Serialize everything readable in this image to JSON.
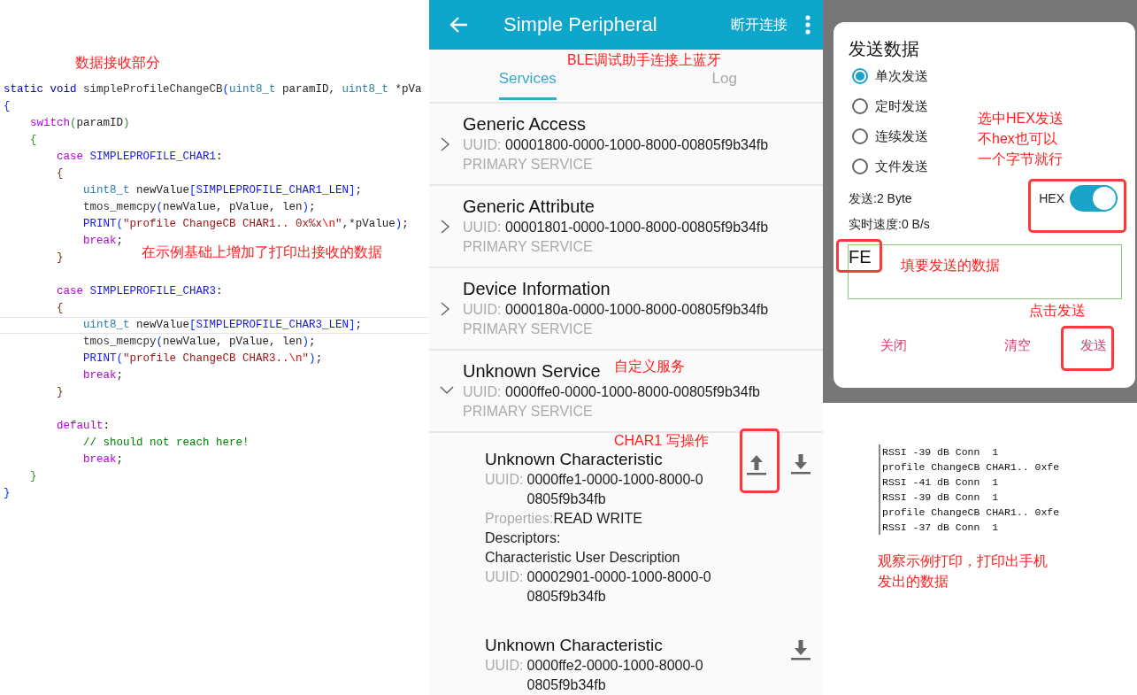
{
  "code": {
    "lines": [
      {
        "kind": "code",
        "tokens": [
          {
            "kind": "kw",
            "text": "static void "
          },
          {
            "kind": "fn",
            "text": "simpleProfileChangeCB"
          },
          {
            "kind": "b1",
            "text": "("
          },
          {
            "kind": "type",
            "text": "uint8_t"
          },
          {
            "kind": "id",
            "text": " paramID, "
          },
          {
            "kind": "type",
            "text": "uint8_t"
          },
          {
            "kind": "id",
            "text": " *pVa"
          }
        ]
      },
      {
        "kind": "code",
        "tokens": [
          {
            "kind": "b1",
            "text": "{"
          }
        ]
      },
      {
        "kind": "code",
        "tokens": [
          {
            "kind": "ctl",
            "text": "    switch"
          },
          {
            "kind": "b2",
            "text": "("
          },
          {
            "kind": "id",
            "text": "paramID"
          },
          {
            "kind": "b2",
            "text": ")"
          }
        ]
      },
      {
        "kind": "code",
        "tokens": [
          {
            "kind": "b2",
            "text": "    {"
          }
        ]
      },
      {
        "kind": "code",
        "tokens": [
          {
            "kind": "ctl",
            "text": "        case "
          },
          {
            "kind": "macro",
            "text": "SIMPLEPROFILE_CHAR1"
          },
          {
            "kind": "id",
            "text": ":"
          }
        ]
      },
      {
        "kind": "code",
        "tokens": [
          {
            "kind": "b3",
            "text": "        {"
          }
        ]
      },
      {
        "kind": "code",
        "tokens": [
          {
            "kind": "type",
            "text": "            uint8_t"
          },
          {
            "kind": "id",
            "text": " newValue"
          },
          {
            "kind": "b1",
            "text": "["
          },
          {
            "kind": "macro",
            "text": "SIMPLEPROFILE_CHAR1_LEN"
          },
          {
            "kind": "b1",
            "text": "]"
          },
          {
            "kind": "id",
            "text": ";"
          }
        ]
      },
      {
        "kind": "code",
        "tokens": [
          {
            "kind": "fn",
            "text": "            tmos_memcpy"
          },
          {
            "kind": "b1",
            "text": "("
          },
          {
            "kind": "id",
            "text": "newValue, pValue, len"
          },
          {
            "kind": "b1",
            "text": ")"
          },
          {
            "kind": "id",
            "text": ";"
          }
        ]
      },
      {
        "kind": "code",
        "tokens": [
          {
            "kind": "macro",
            "text": "            PRINT"
          },
          {
            "kind": "b1",
            "text": "("
          },
          {
            "kind": "str",
            "text": "\"profile ChangeCB CHAR1.. 0x%x"
          },
          {
            "kind": "esc",
            "text": "\\n"
          },
          {
            "kind": "str",
            "text": "\""
          },
          {
            "kind": "id",
            "text": ",*pValue"
          },
          {
            "kind": "b1",
            "text": ")"
          },
          {
            "kind": "id",
            "text": ";"
          }
        ]
      },
      {
        "kind": "code",
        "tokens": [
          {
            "kind": "ctl",
            "text": "            break"
          },
          {
            "kind": "id",
            "text": ";"
          }
        ]
      },
      {
        "kind": "code",
        "tokens": [
          {
            "kind": "b3",
            "text": "        }"
          }
        ]
      },
      {
        "kind": "blank"
      },
      {
        "kind": "code",
        "tokens": [
          {
            "kind": "ctl",
            "text": "        case "
          },
          {
            "kind": "macro",
            "text": "SIMPLEPROFILE_CHAR3"
          },
          {
            "kind": "id",
            "text": ":"
          }
        ]
      },
      {
        "kind": "code",
        "tokens": [
          {
            "kind": "b3",
            "text": "        {"
          }
        ]
      },
      {
        "kind": "code",
        "current": true,
        "tokens": [
          {
            "kind": "type",
            "text": "            uint8_t"
          },
          {
            "kind": "id",
            "text": " newValue"
          },
          {
            "kind": "b1",
            "text": "["
          },
          {
            "kind": "macro",
            "text": "SIMPLEPROFILE_CHAR3_LEN"
          },
          {
            "kind": "b1",
            "text": "]"
          },
          {
            "kind": "id",
            "text": ";"
          }
        ]
      },
      {
        "kind": "code",
        "tokens": [
          {
            "kind": "fn",
            "text": "            tmos_memcpy"
          },
          {
            "kind": "b1",
            "text": "("
          },
          {
            "kind": "id",
            "text": "newValue, pValue, len"
          },
          {
            "kind": "b1",
            "text": ")"
          },
          {
            "kind": "id",
            "text": ";"
          }
        ]
      },
      {
        "kind": "code",
        "tokens": [
          {
            "kind": "macro",
            "text": "            PRINT"
          },
          {
            "kind": "b1",
            "text": "("
          },
          {
            "kind": "str",
            "text": "\"profile ChangeCB CHAR3.."
          },
          {
            "kind": "esc",
            "text": "\\n"
          },
          {
            "kind": "str",
            "text": "\""
          },
          {
            "kind": "b1",
            "text": ")"
          },
          {
            "kind": "id",
            "text": ";"
          }
        ]
      },
      {
        "kind": "code",
        "tokens": [
          {
            "kind": "ctl",
            "text": "            break"
          },
          {
            "kind": "id",
            "text": ";"
          }
        ]
      },
      {
        "kind": "code",
        "tokens": [
          {
            "kind": "b3",
            "text": "        }"
          }
        ]
      },
      {
        "kind": "blank"
      },
      {
        "kind": "code",
        "tokens": [
          {
            "kind": "ctl",
            "text": "        default"
          },
          {
            "kind": "id",
            "text": ":"
          }
        ]
      },
      {
        "kind": "code",
        "tokens": [
          {
            "kind": "cm",
            "text": "            // should not reach here!"
          }
        ]
      },
      {
        "kind": "code",
        "tokens": [
          {
            "kind": "ctl",
            "text": "            break"
          },
          {
            "kind": "id",
            "text": ";"
          }
        ]
      },
      {
        "kind": "code",
        "tokens": [
          {
            "kind": "b2",
            "text": "    }"
          }
        ]
      },
      {
        "kind": "code",
        "tokens": [
          {
            "kind": "b1",
            "text": "}"
          }
        ]
      }
    ]
  },
  "app": {
    "title": "Simple Peripheral",
    "action": "断开连接",
    "tabs": [
      {
        "label": "Services",
        "selected": true
      },
      {
        "label": "Log",
        "selected": false
      }
    ],
    "services": [
      {
        "name": "Generic Access",
        "uuid_label": "UUID:",
        "uuid": "00001800-0000-1000-8000-00805f9b34fb",
        "type": "PRIMARY SERVICE",
        "expanded": false
      },
      {
        "name": "Generic Attribute",
        "uuid_label": "UUID:",
        "uuid": "00001801-0000-1000-8000-00805f9b34fb",
        "type": "PRIMARY SERVICE",
        "expanded": false
      },
      {
        "name": "Device Information",
        "uuid_label": "UUID:",
        "uuid": "0000180a-0000-1000-8000-00805f9b34fb",
        "type": "PRIMARY SERVICE",
        "expanded": false
      },
      {
        "name": "Unknown Service",
        "uuid_label": "UUID:",
        "uuid": "0000ffe0-0000-1000-8000-00805f9b34fb",
        "type": "PRIMARY SERVICE",
        "expanded": true,
        "characteristics": [
          {
            "name": "Unknown Characteristic",
            "uuid_label": "UUID:",
            "uuid": "0000ffe1-0000-1000-8000-00805f9b34fb",
            "properties_label": "Properties:",
            "properties": "READ WRITE",
            "descriptors_label": "Descriptors:",
            "descriptors": [
              {
                "name": "Characteristic User Description",
                "uuid_label": "UUID:",
                "uuid": "00002901-0000-1000-8000-00805f9b34fb"
              }
            ],
            "write": true,
            "read": true
          },
          {
            "name": "Unknown Characteristic",
            "uuid_label": "UUID:",
            "uuid": "0000ffe2-0000-1000-8000-00805f9b34fb",
            "write": false,
            "read": true
          }
        ]
      }
    ]
  },
  "dialog": {
    "title": "发送数据",
    "modes": [
      {
        "label": "单次发送",
        "selected": true
      },
      {
        "label": "定时发送",
        "selected": false
      },
      {
        "label": "连续发送",
        "selected": false
      },
      {
        "label": "文件发送",
        "selected": false
      }
    ],
    "sent": "发送:2 Byte",
    "speed": "实时速度:0 B/s",
    "hex": {
      "label": "HEX",
      "on": true
    },
    "input": {
      "value": "FE"
    },
    "buttons": [
      "关闭",
      "清空",
      "发送"
    ]
  },
  "terminal": {
    "lines": [
      "RSSI -39 dB Conn  1",
      "profile ChangeCB CHAR1.. 0xfe",
      "RSSI -41 dB Conn  1",
      "RSSI -39 dB Conn  1",
      "profile ChangeCB CHAR1.. 0xfe",
      "RSSI -37 dB Conn  1"
    ]
  },
  "annotations": [
    {
      "text": "数据接收部分"
    },
    {
      "text": "在示例基础上增加了打印出接收的数据"
    },
    {
      "text": "BLE调试助手连接上蓝牙"
    },
    {
      "text": "自定义服务"
    },
    {
      "text": "CHAR1 写操作"
    },
    {
      "text": "选中HEX发送"
    },
    {
      "text": "不hex也可以"
    },
    {
      "text": "一个字节就行"
    },
    {
      "text": "填要发送的数据"
    },
    {
      "text": "点击发送"
    },
    {
      "text": "观察示例打印，打印出手机发出的数据"
    }
  ]
}
